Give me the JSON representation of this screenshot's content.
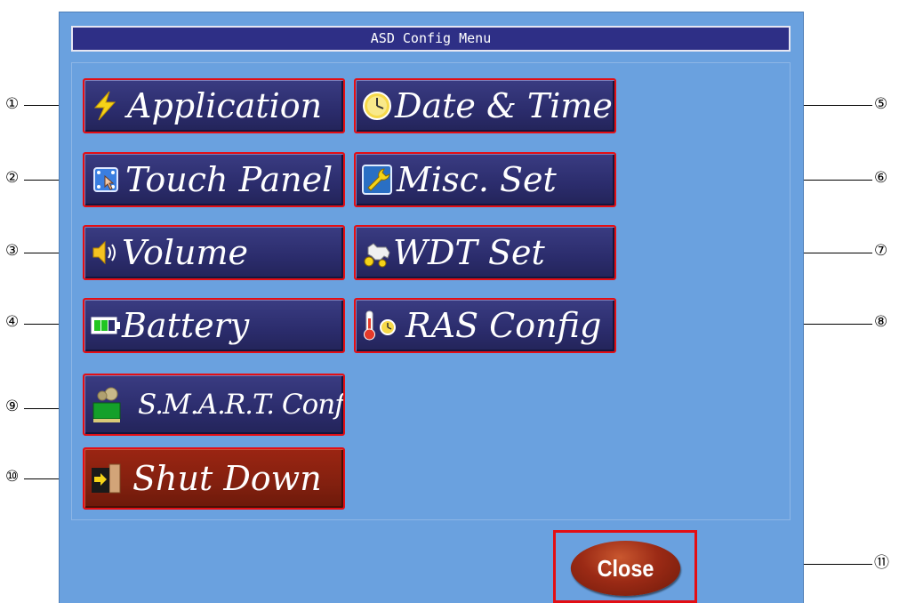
{
  "window": {
    "title": "ASD Config Menu"
  },
  "menu": {
    "application": "Application",
    "date_time": "Date & Time",
    "touch_panel": "Touch Panel",
    "misc_set": "Misc. Set",
    "volume": "Volume",
    "wdt_set": "WDT Set",
    "battery": "Battery",
    "ras_config": "RAS Config",
    "smart_config": "S.M.A.R.T. Config",
    "shut_down": "Shut Down"
  },
  "close_label": "Close",
  "callouts": [
    "①",
    "②",
    "③",
    "④",
    "⑤",
    "⑥",
    "⑦",
    "⑧",
    "⑨",
    "⑩",
    "⑪"
  ],
  "colors": {
    "panel_bg": "#6aa1df",
    "title_bar": "#2e2f86",
    "button_navy": "#2b2c6c",
    "button_red": "#82200f",
    "highlight_border": "#e30e14"
  },
  "icons": {
    "application": "lightning-icon",
    "date_time": "clock-icon",
    "touch_panel": "touch-panel-icon",
    "misc_set": "wrench-icon",
    "volume": "speaker-icon",
    "wdt_set": "watchdog-icon",
    "battery": "battery-icon",
    "ras_config": "thermometer-icon",
    "smart_config": "disk-gear-icon",
    "shut_down": "exit-door-icon"
  }
}
